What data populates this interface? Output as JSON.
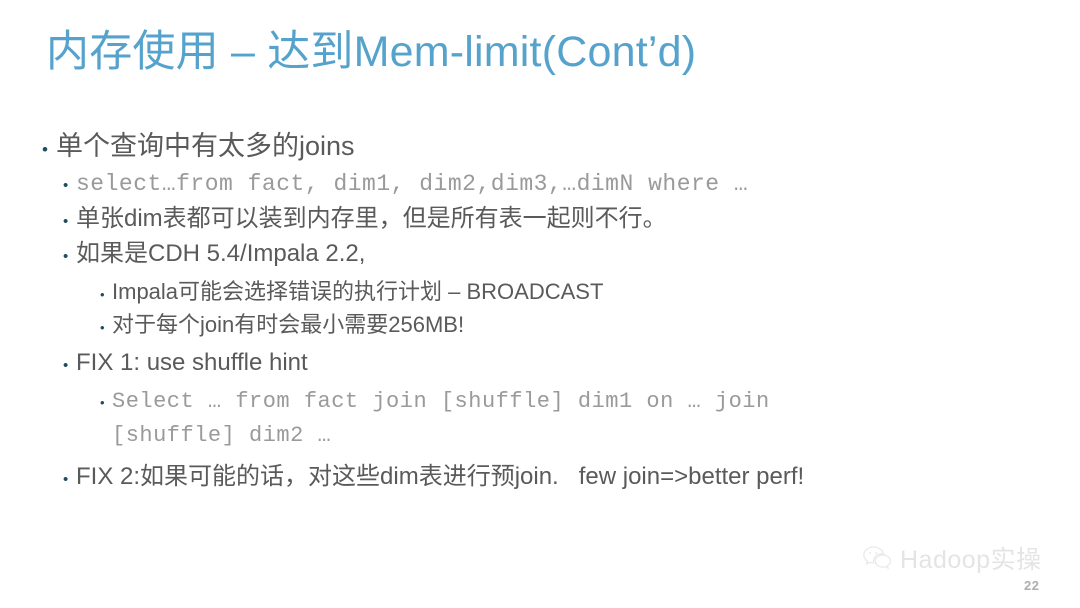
{
  "slide": {
    "title": "内存使用 – 达到Mem-limit(Cont’d)",
    "title_color": "#55a3cc",
    "body_color": "#5a5a5a",
    "bullet_color": "#1d4e5e",
    "code_color": "#9a9a9a",
    "background": "#ffffff",
    "bullet_glyph": "•"
  },
  "content": {
    "lines": [
      {
        "level": 1,
        "mono": false,
        "text": "单个查询中有太多的joins"
      },
      {
        "level": 2,
        "mono": true,
        "text": "select…from fact, dim1, dim2,dim3,…dimN where …"
      },
      {
        "level": 2,
        "mono": false,
        "text": "单张dim表都可以装到内存里，但是所有表一起则不行。"
      },
      {
        "level": 2,
        "mono": false,
        "text": "如果是CDH 5.4/Impala 2.2,"
      },
      {
        "level": 3,
        "mono": false,
        "text": "Impala可能会选择错误的执行计划 – BROADCAST"
      },
      {
        "level": 3,
        "mono": false,
        "text": "对于每个join有时会最小需要256MB!"
      },
      {
        "level": 2,
        "mono": false,
        "text": "FIX 1: use shuffle hint"
      },
      {
        "level": 3,
        "mono": true,
        "text": "Select … from fact join [shuffle] dim1 on … join"
      },
      {
        "level": 0,
        "mono": true,
        "text": "[shuffle] dim2 …"
      },
      {
        "level": 2,
        "mono": false,
        "text": "FIX 2:如果可能的话，对这些dim表进行预join.   few join=>better perf!"
      }
    ]
  },
  "footer": {
    "watermark_text": "Hadoop实操",
    "watermark_icon": "wechat-icon",
    "page_number": "22"
  }
}
